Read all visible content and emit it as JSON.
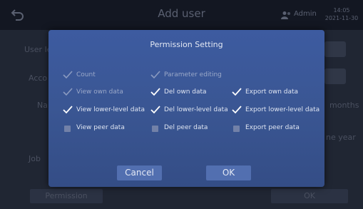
{
  "screen": {
    "title": "Add user",
    "user": "Admin",
    "time": "14:05",
    "date": "2021-11-30",
    "labels": {
      "user_level": "User le",
      "account": "Acco",
      "name": "Na",
      "job": "Job"
    },
    "side": {
      "months": "months",
      "one_year": "ne year"
    },
    "bottom": {
      "permission": "Permission",
      "ok": "OK"
    }
  },
  "dialog": {
    "title": "Permission Setting",
    "rows": [
      [
        {
          "label": "Count",
          "state": "checked-disabled"
        },
        {
          "label": "Parameter editing",
          "state": "checked-disabled"
        }
      ],
      [
        {
          "label": "View own data",
          "state": "checked-disabled"
        },
        {
          "label": "Del own data",
          "state": "checked"
        },
        {
          "label": "Export own data",
          "state": "checked"
        }
      ],
      [
        {
          "label": "View lower-level data",
          "state": "checked"
        },
        {
          "label": "Del lower-level data",
          "state": "checked"
        },
        {
          "label": "Export lower-level data",
          "state": "checked"
        }
      ],
      [
        {
          "label": "View peer data",
          "state": "unchecked"
        },
        {
          "label": "Del peer data",
          "state": "unchecked"
        },
        {
          "label": "Export peer data",
          "state": "unchecked"
        }
      ]
    ],
    "cancel": "Cancel",
    "ok": "OK"
  },
  "colors": {
    "dialog_bg": "#3a5693",
    "button_bg": "#526fb0",
    "check": "#ffffff",
    "check_disabled": "#8a9ac0"
  }
}
